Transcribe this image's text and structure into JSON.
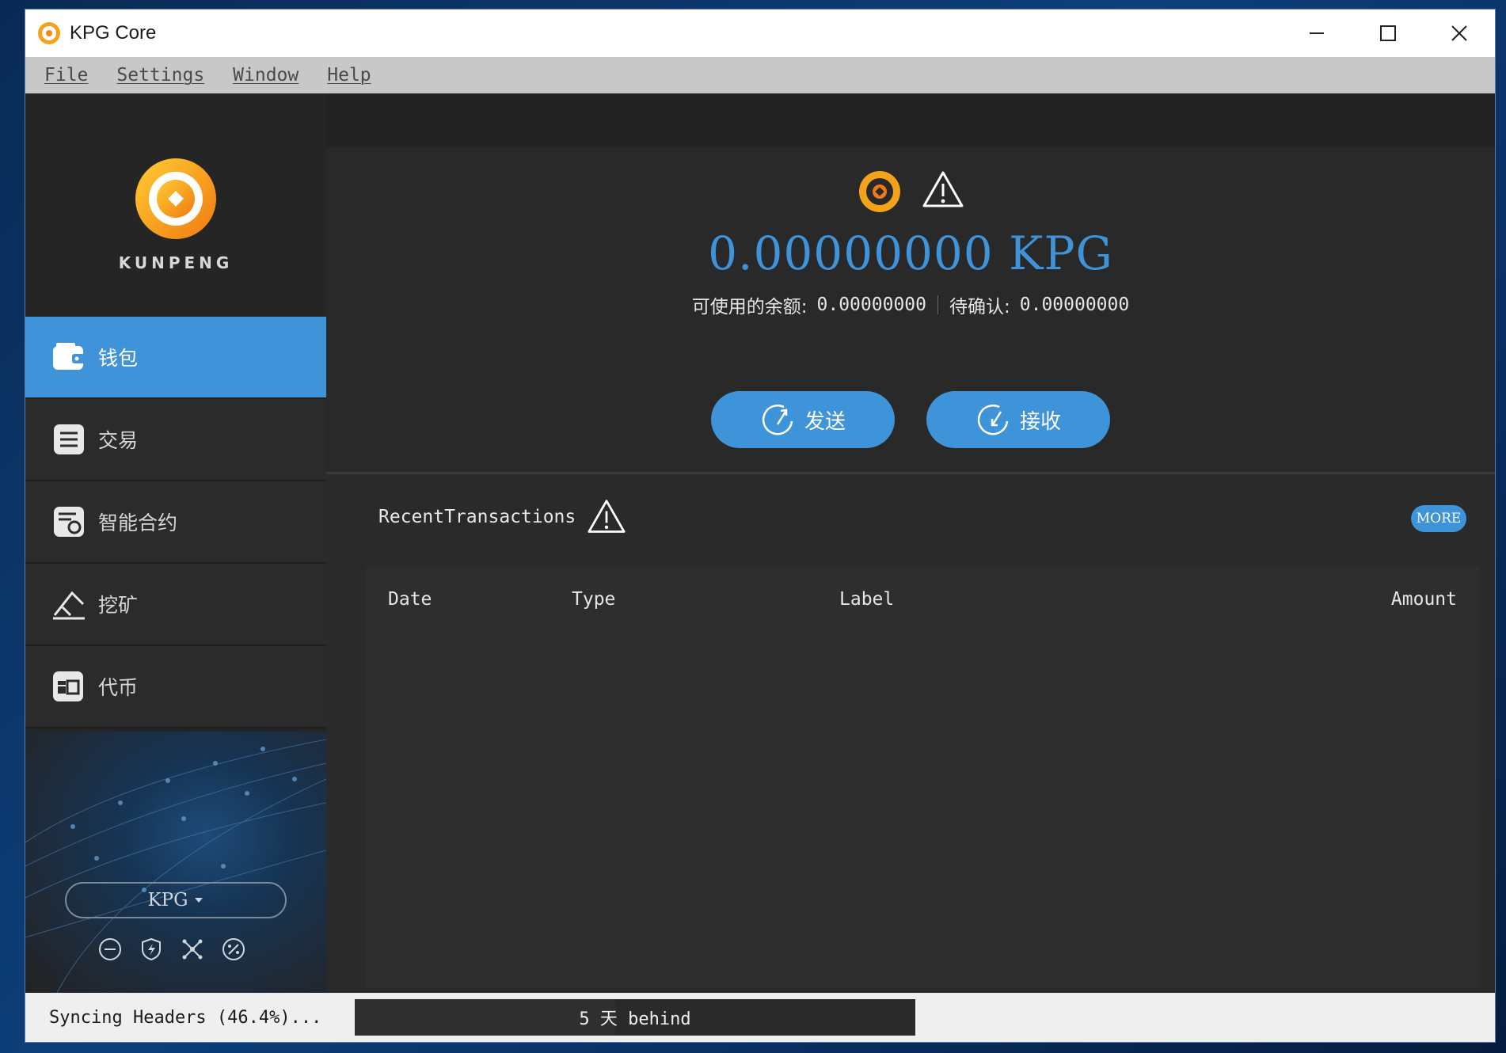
{
  "window": {
    "title": "KPG Core"
  },
  "menu": {
    "items": [
      "File",
      "Settings",
      "Window",
      "Help"
    ]
  },
  "sidebar": {
    "brand": "KUNPENG",
    "items": [
      {
        "label": "钱包",
        "icon": "wallet-icon",
        "active": true
      },
      {
        "label": "交易",
        "icon": "transactions-icon",
        "active": false
      },
      {
        "label": "智能合约",
        "icon": "smart-contract-icon",
        "active": false
      },
      {
        "label": "挖矿",
        "icon": "mining-icon",
        "active": false
      },
      {
        "label": "代币",
        "icon": "token-icon",
        "active": false
      }
    ],
    "coin_select": "KPG"
  },
  "overview": {
    "balance": "0.00000000 KPG",
    "available_label": "可使用的余额:",
    "available_value": "0.00000000",
    "pending_label": "待确认:",
    "pending_value": "0.00000000",
    "send_label": "发送",
    "receive_label": "接收"
  },
  "recent": {
    "title": "RecentTransactions",
    "more_label": "MORE",
    "columns": [
      "Date",
      "Type",
      "Label",
      "Amount"
    ],
    "rows": []
  },
  "status": {
    "sync_text": "Syncing Headers (46.4%)...",
    "progress_text": "5 天 behind",
    "progress": 0.464
  },
  "colors": {
    "accent": "#3f93d9",
    "background": "#232323"
  }
}
